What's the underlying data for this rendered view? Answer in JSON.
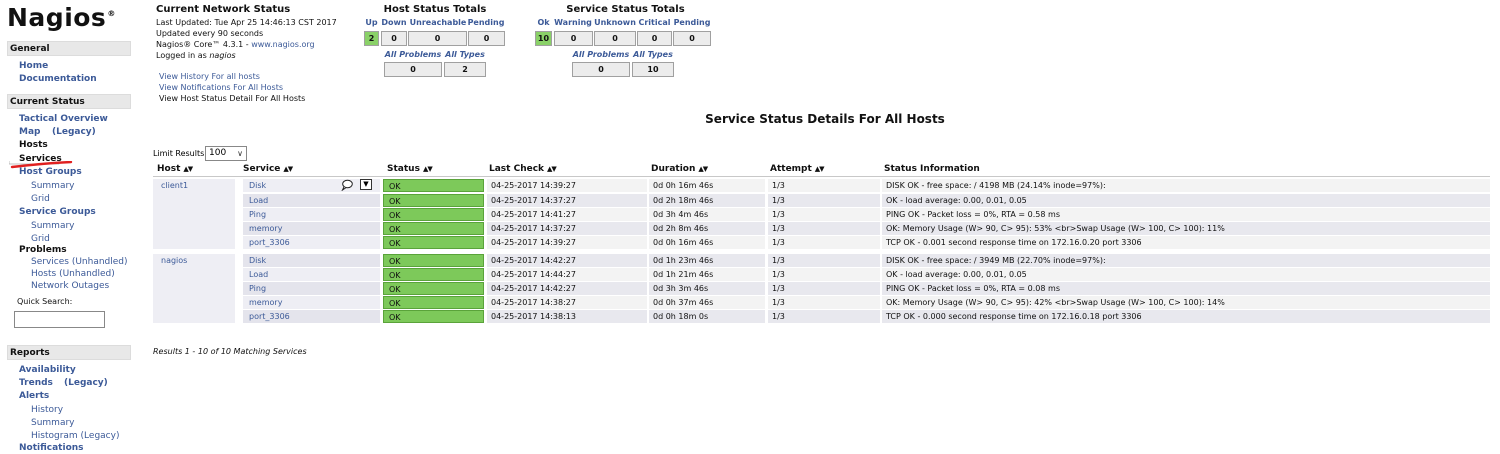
{
  "logo": {
    "text": "Nagios",
    "reg": "®"
  },
  "sidebar": {
    "sections": [
      {
        "title": "General"
      },
      {
        "title": "Current Status"
      },
      {
        "title": "Reports"
      }
    ],
    "general": [
      "Home",
      "Documentation"
    ],
    "current_status": {
      "tactical_overview": "Tactical Overview",
      "map": "Map",
      "legacy": "(Legacy)",
      "hosts": "Hosts",
      "services": "Services",
      "host_groups": "Host Groups",
      "hg_summary": "Summary",
      "hg_grid": "Grid",
      "service_groups": "Service Groups",
      "sg_summary": "Summary",
      "sg_grid": "Grid",
      "problems": "Problems",
      "services_unhandled": "Services",
      "hosts_unhandled": "Hosts",
      "unhandled": "(Unhandled)",
      "network_outages": "Network Outages",
      "quick_search": "Quick Search:"
    },
    "reports": {
      "availability": "Availability",
      "trends": "Trends",
      "legacy": "(Legacy)",
      "alerts": "Alerts",
      "history": "History",
      "summary": "Summary",
      "histogram": "Histogram (Legacy)",
      "notifications_partial": "Notifications"
    }
  },
  "network_status": {
    "title": "Current Network Status",
    "last_updated": "Last Updated: Tue Apr 25 14:46:13 CST 2017",
    "update_interval": "Updated every 90 seconds",
    "version_prefix": "Nagios® Core™ 4.3.1 - ",
    "version_link": "www.nagios.org",
    "logged_in_prefix": "Logged in as ",
    "logged_in_user": "nagios",
    "links": [
      "View History For all hosts",
      "View Notifications For All Hosts",
      "View Host Status Detail For All Hosts"
    ]
  },
  "host_totals": {
    "title": "Host Status Totals",
    "headers": [
      "Up",
      "Down",
      "Unreachable",
      "Pending"
    ],
    "values": [
      "2",
      "0",
      "0",
      "0"
    ],
    "sub_headers": [
      "All Problems",
      "All Types"
    ],
    "sub_values": [
      "0",
      "2"
    ]
  },
  "service_totals": {
    "title": "Service Status Totals",
    "headers": [
      "Ok",
      "Warning",
      "Unknown",
      "Critical",
      "Pending"
    ],
    "values": [
      "10",
      "0",
      "0",
      "0",
      "0"
    ],
    "sub_headers": [
      "All Problems",
      "All Types"
    ],
    "sub_values": [
      "0",
      "10"
    ]
  },
  "page_heading": "Service Status Details For All Hosts",
  "limit": {
    "label": "Limit Results:",
    "value": "100"
  },
  "table": {
    "columns": [
      "Host",
      "Service",
      "Status",
      "Last Check",
      "Duration",
      "Attempt",
      "Status Information"
    ],
    "rows": [
      {
        "host": "client1",
        "service": "Disk",
        "status": "OK",
        "last_check": "04-25-2017 14:39:27",
        "duration": "0d 0h 16m 46s",
        "attempt": "1/3",
        "info": "DISK OK - free space: / 4198 MB (24.14% inode=97%):"
      },
      {
        "host": "",
        "service": "Load",
        "status": "OK",
        "last_check": "04-25-2017 14:37:27",
        "duration": "0d 2h 18m 46s",
        "attempt": "1/3",
        "info": "OK - load average: 0.00, 0.01, 0.05"
      },
      {
        "host": "",
        "service": "Ping",
        "status": "OK",
        "last_check": "04-25-2017 14:41:27",
        "duration": "0d 3h 4m 46s",
        "attempt": "1/3",
        "info": "PING OK - Packet loss = 0%, RTA = 0.58 ms"
      },
      {
        "host": "",
        "service": "memory",
        "status": "OK",
        "last_check": "04-25-2017 14:37:27",
        "duration": "0d 2h 8m 46s",
        "attempt": "1/3",
        "info": "OK: Memory Usage (W> 90, C> 95): 53% <br>Swap Usage (W> 100, C> 100): 11%"
      },
      {
        "host": "",
        "service": "port_3306",
        "status": "OK",
        "last_check": "04-25-2017 14:39:27",
        "duration": "0d 0h 16m 46s",
        "attempt": "1/3",
        "info": "TCP OK - 0.001 second response time on 172.16.0.20 port 3306"
      },
      {
        "host": "nagios",
        "service": "Disk",
        "status": "OK",
        "last_check": "04-25-2017 14:42:27",
        "duration": "0d 1h 23m 46s",
        "attempt": "1/3",
        "info": "DISK OK - free space: / 3949 MB (22.70% inode=97%):"
      },
      {
        "host": "",
        "service": "Load",
        "status": "OK",
        "last_check": "04-25-2017 14:44:27",
        "duration": "0d 1h 21m 46s",
        "attempt": "1/3",
        "info": "OK - load average: 0.00, 0.01, 0.05"
      },
      {
        "host": "",
        "service": "Ping",
        "status": "OK",
        "last_check": "04-25-2017 14:42:27",
        "duration": "0d 3h 3m 46s",
        "attempt": "1/3",
        "info": "PING OK - Packet loss = 0%, RTA = 0.08 ms"
      },
      {
        "host": "",
        "service": "memory",
        "status": "OK",
        "last_check": "04-25-2017 14:38:27",
        "duration": "0d 0h 37m 46s",
        "attempt": "1/3",
        "info": "OK: Memory Usage (W> 90, C> 95): 42% <br>Swap Usage (W> 100, C> 100): 14%"
      },
      {
        "host": "",
        "service": "port_3306",
        "status": "OK",
        "last_check": "04-25-2017 14:38:13",
        "duration": "0d 0h 18m 0s",
        "attempt": "1/3",
        "info": "TCP OK - 0.000 second response time on 172.16.0.18 port 3306"
      }
    ]
  },
  "results_summary": "Results 1 - 10 of 10 Matching Services",
  "colors": {
    "ok_green": "#7dc95a",
    "link_blue": "#3c5a98",
    "annotation_red": "#e02020"
  },
  "icons": {
    "sort": "sort-arrows-icon",
    "comment": "comment-icon",
    "menu": "dropdown-menu-icon"
  }
}
